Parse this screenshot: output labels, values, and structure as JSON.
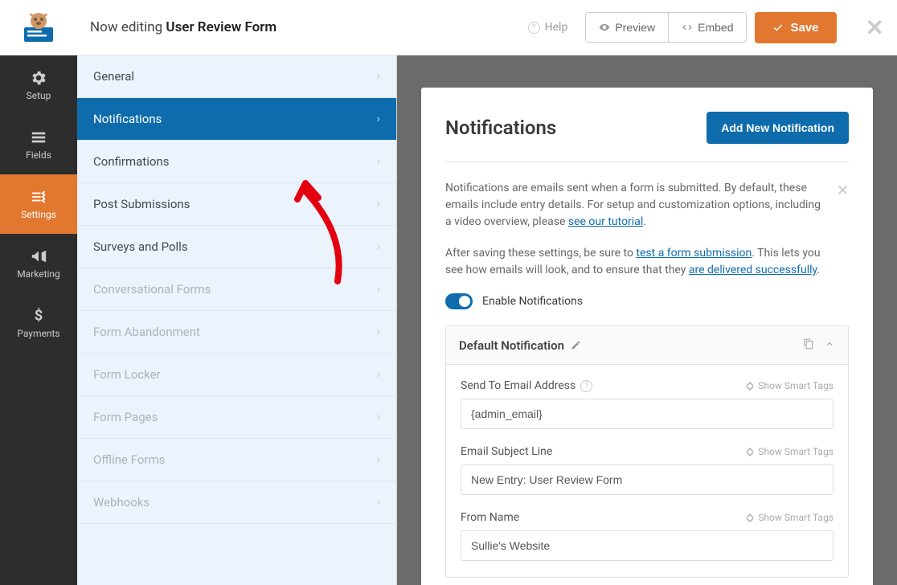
{
  "topbar": {
    "editing_prefix": "Now editing",
    "form_name": "User Review Form",
    "help": "Help",
    "preview": "Preview",
    "embed": "Embed",
    "save": "Save"
  },
  "rail": [
    {
      "key": "setup",
      "label": "Setup"
    },
    {
      "key": "fields",
      "label": "Fields"
    },
    {
      "key": "settings",
      "label": "Settings",
      "active": true
    },
    {
      "key": "marketing",
      "label": "Marketing"
    },
    {
      "key": "payments",
      "label": "Payments"
    }
  ],
  "subnav": [
    {
      "label": "General",
      "muted": false
    },
    {
      "label": "Notifications",
      "muted": false,
      "active": true
    },
    {
      "label": "Confirmations",
      "muted": false
    },
    {
      "label": "Post Submissions",
      "muted": false
    },
    {
      "label": "Surveys and Polls",
      "muted": false
    },
    {
      "label": "Conversational Forms",
      "muted": true
    },
    {
      "label": "Form Abandonment",
      "muted": true
    },
    {
      "label": "Form Locker",
      "muted": true
    },
    {
      "label": "Form Pages",
      "muted": true
    },
    {
      "label": "Offline Forms",
      "muted": true
    },
    {
      "label": "Webhooks",
      "muted": true
    }
  ],
  "panel": {
    "title": "Notifications",
    "add_button": "Add New Notification",
    "desc_p1_pre": "Notifications are emails sent when a form is submitted. By default, these emails include entry details. For setup and customization options, including a video overview, please ",
    "desc_p1_link": "see our tutorial",
    "desc_p1_post": ".",
    "desc_p2_pre": "After saving these settings, be sure to ",
    "desc_p2_link": "test a form submission",
    "desc_p2_post": ". This lets you see how emails will look, and to ensure that they ",
    "desc_p2_link2": "are delivered successfully",
    "desc_p2_post2": ".",
    "enable_label": "Enable Notifications"
  },
  "card": {
    "title": "Default Notification",
    "fields": {
      "send_to": {
        "label": "Send To Email Address",
        "value": "{admin_email}",
        "help": true
      },
      "subject": {
        "label": "Email Subject Line",
        "value": "New Entry: User Review Form"
      },
      "from_name": {
        "label": "From Name",
        "value": "Sullie's Website"
      }
    },
    "smart_tags": "Show Smart Tags"
  }
}
